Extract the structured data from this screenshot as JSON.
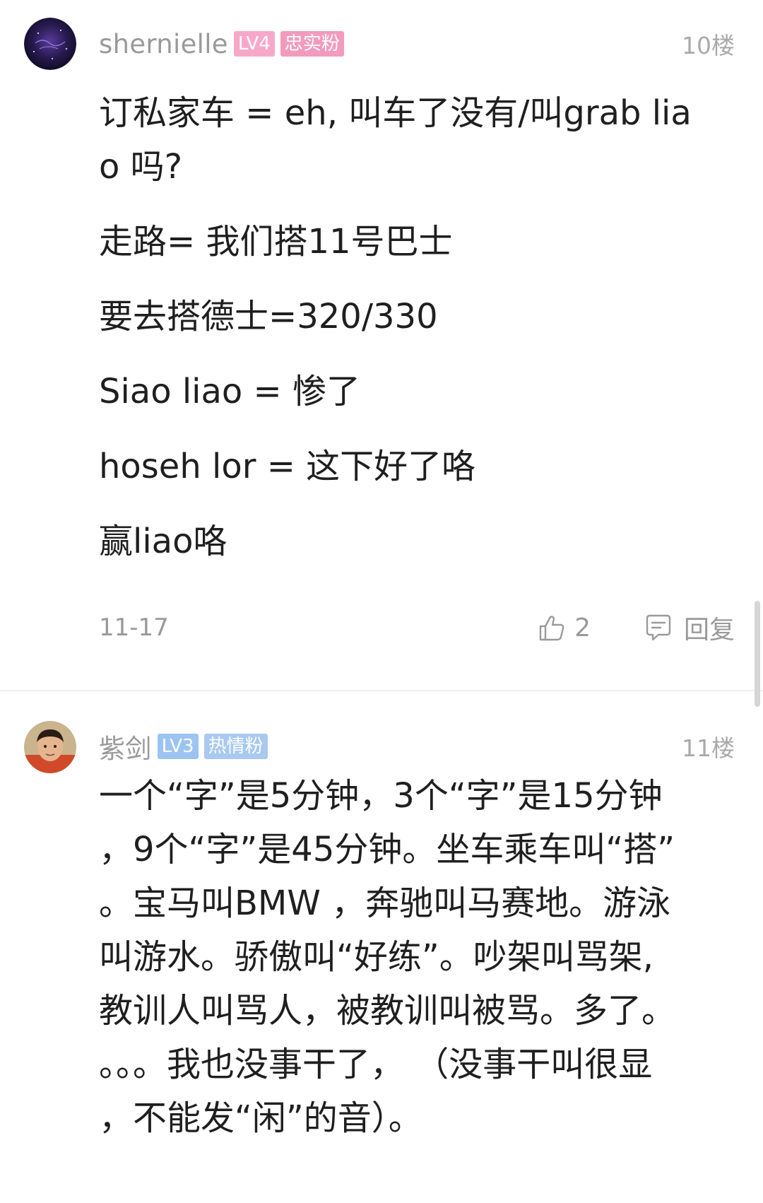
{
  "colors": {
    "lv4_badge": "#f7a8c8",
    "fan4_badge": "#f29bbc",
    "lv3_badge": "#9cc4f2",
    "fan3_badge": "#a9c9f0",
    "meta_text": "#9a9a9a"
  },
  "comments": [
    {
      "avatar_icon": "galaxy-avatar-icon",
      "username": "shernielle",
      "level": "LV4",
      "fan_badge": "忠实粉",
      "floor": "10楼",
      "lines": [
        "订私家车 = eh, 叫车了没有/叫grab lia",
        "o 吗?",
        "走路= 我们搭11号巴士",
        "要去搭德士=320/330",
        "Siao liao = 惨了",
        "hoseh lor = 这下好了咯",
        "赢liao咯"
      ],
      "date": "11-17",
      "like_icon": "thumbs-up-icon",
      "like_count": "2",
      "reply_icon": "comment-bubble-icon",
      "reply_label": "回复"
    },
    {
      "avatar_icon": "child-photo-avatar-icon",
      "username": "紫剑",
      "level": "LV3",
      "fan_badge": "热情粉",
      "floor": "11楼",
      "lines": [
        "一个“字”是5分钟，3个“字”是15分钟",
        "，9个“字”是45分钟。坐车乘车叫“搭”",
        "。宝马叫BMW ，奔驰叫马赛地。游泳",
        "叫游水。骄傲叫“好练”。吵架叫骂架,",
        "教训人叫骂人，被教训叫被骂。多了。",
        "。。。我也没事干了， （没事干叫很显",
        "，不能发“闲”的音）。"
      ]
    }
  ]
}
